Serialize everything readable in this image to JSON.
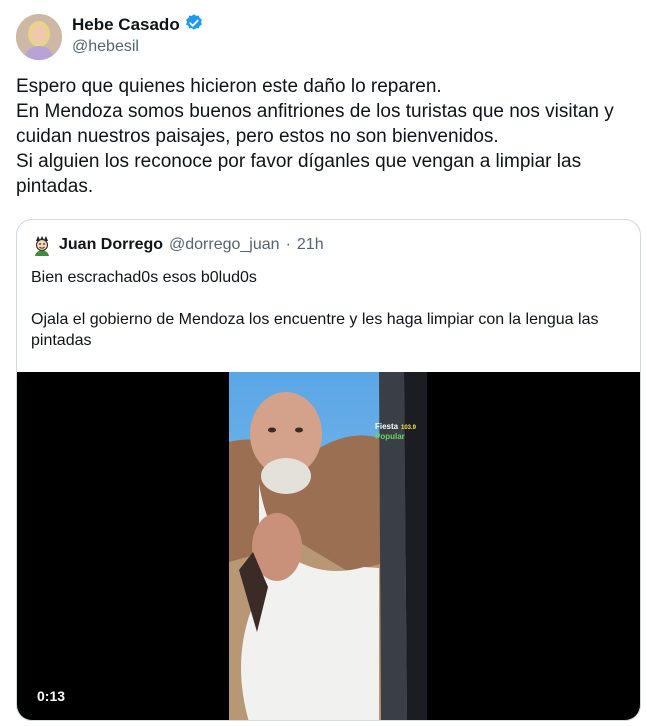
{
  "author": {
    "name": "Hebe Casado",
    "handle": "@hebesil",
    "verified_color": "#1d9bf0"
  },
  "tweet": {
    "lines": [
      "Espero que quienes hicieron este daño lo reparen.",
      "En Mendoza somos buenos anfitriones de los turistas que nos visitan y",
      "cuidan nuestros paisajes, pero estos no son bienvenidos.",
      "Si alguien los reconoce por favor díganles que vengan a limpiar las",
      "pintadas."
    ]
  },
  "quoted": {
    "name": "Juan Dorrego",
    "handle": "@dorrego_juan",
    "separator": "·",
    "time": "21h",
    "paragraphs": [
      "Bien escrachad0s esos b0lud0s",
      "Ojala el gobierno de Mendoza los encuentre y les haga limpiar con la lengua las pintadas"
    ],
    "video": {
      "duration": "0:13",
      "overlay_logo": [
        "Fiesta",
        "103.9",
        "Popular"
      ]
    }
  },
  "colors": {
    "text": "#0f1419",
    "secondary": "#536471",
    "border": "#cfd9de"
  }
}
